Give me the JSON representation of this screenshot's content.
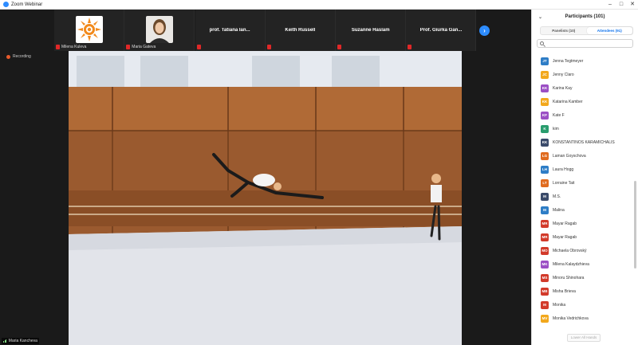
{
  "window": {
    "title": "Zoom Webinar",
    "controls": [
      "–",
      "□",
      "✕"
    ]
  },
  "top_strip": [
    {
      "name": "Milena Kuleva",
      "kind": "photo",
      "icon": "sun-logo-icon"
    },
    {
      "name": "Maria Gateva",
      "kind": "photo",
      "icon": "woman-portrait-icon"
    },
    {
      "name": "prof. Tatiana Ian...",
      "kind": "text"
    },
    {
      "name": "Keith Russell",
      "kind": "text"
    },
    {
      "name": "Suzanne Haslam",
      "kind": "text"
    },
    {
      "name": "Prof. Giurka Gan...",
      "kind": "text"
    }
  ],
  "next_page_icon": "chevron-right-icon",
  "recording_label": "Recording",
  "main_video": {
    "speaker_name": "Maria Kancheva"
  },
  "participants": {
    "header": "Participants (101)",
    "tabs": [
      {
        "label": "Panelists (10)",
        "active": false
      },
      {
        "label": "Attendees (91)",
        "active": true
      }
    ],
    "search_placeholder": "",
    "items": [
      {
        "initials": "JT",
        "name": "Jenna Tegtmeyer",
        "color": "#2e7dc6"
      },
      {
        "initials": "JC",
        "name": "Jenny Claro",
        "color": "#f2a81d"
      },
      {
        "initials": "KK",
        "name": "Karina Kay",
        "color": "#9b4fc4"
      },
      {
        "initials": "KK",
        "name": "Katarina Kamber",
        "color": "#f2a81d"
      },
      {
        "initials": "KF",
        "name": "Kate F",
        "color": "#9b4fc4"
      },
      {
        "initials": "K",
        "name": "kim",
        "color": "#2a9d6e"
      },
      {
        "initials": "KK",
        "name": "KONSTANTINOS KARAMICHALIS",
        "color": "#3a4a6a"
      },
      {
        "initials": "LG",
        "name": "Laman Goyschova",
        "color": "#e06b1f"
      },
      {
        "initials": "LH",
        "name": "Laura Hogg",
        "color": "#2e7dc6"
      },
      {
        "initials": "LT",
        "name": "Lorraine Tait",
        "color": "#e06b1f"
      },
      {
        "initials": "M",
        "name": "M.S.",
        "color": "#3a4a6a"
      },
      {
        "initials": "M",
        "name": "Malina",
        "color": "#2e7dc6"
      },
      {
        "initials": "MR",
        "name": "Mayar Ragab",
        "color": "#d23a2a"
      },
      {
        "initials": "MR",
        "name": "Mayar Ragab",
        "color": "#d23a2a"
      },
      {
        "initials": "MO",
        "name": "Michaela Obrovský",
        "color": "#d23a2a"
      },
      {
        "initials": "MK",
        "name": "Milena Kalaydzhieva",
        "color": "#9b4fc4"
      },
      {
        "initials": "MS",
        "name": "Minoru Shinohara",
        "color": "#d23a2a"
      },
      {
        "initials": "MB",
        "name": "Misha Brieva",
        "color": "#d23a2a"
      },
      {
        "initials": "M",
        "name": "Monika",
        "color": "#d23a2a"
      },
      {
        "initials": "MV",
        "name": "Monika Vedrichkova",
        "color": "#f2a81d"
      }
    ],
    "lower_all_label": "Lower All Hands"
  }
}
